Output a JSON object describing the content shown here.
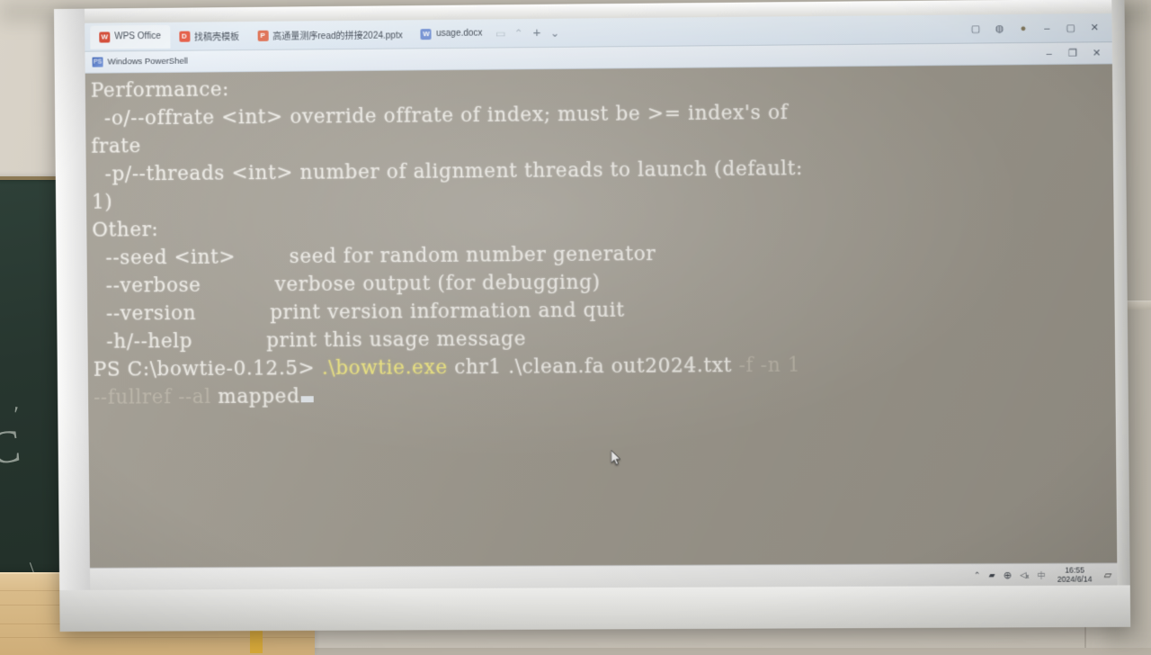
{
  "scene": {
    "description": "classroom projector screen showing Windows PowerShell",
    "chalkboard_label": "chalkboard",
    "chalk_marks": [
      "C",
      "'",
      "/"
    ]
  },
  "wps_tabs": {
    "tabs": [
      {
        "label": "WPS Office",
        "icon": "wps-logo-icon",
        "icon_class": "ic-wps",
        "icon_glyph": "W",
        "active": true
      },
      {
        "label": "找稿壳模板",
        "icon": "template-icon",
        "icon_class": "ic-doc",
        "icon_glyph": "D",
        "active": false
      },
      {
        "label": "高通量测序read的拼接2024.pptx",
        "icon": "powerpoint-icon",
        "icon_class": "ic-ppt",
        "icon_glyph": "P",
        "active": false
      },
      {
        "label": "usage.docx",
        "icon": "word-icon",
        "icon_class": "ic-docx",
        "icon_glyph": "W",
        "active": false
      }
    ],
    "tab_controls": [
      {
        "name": "tab-list-icon",
        "glyph": "▭"
      },
      {
        "name": "chevron-up-icon",
        "glyph": "⌃"
      },
      {
        "name": "new-tab-button",
        "glyph": "+"
      },
      {
        "name": "new-tab-dropdown-icon",
        "glyph": "⌄"
      }
    ],
    "right_controls": [
      {
        "name": "sidebar-toggle-icon",
        "glyph": "▢"
      },
      {
        "name": "globe-icon",
        "glyph": "◍"
      },
      {
        "name": "account-avatar",
        "glyph": "●"
      },
      {
        "name": "minimize-button",
        "glyph": "–"
      },
      {
        "name": "maximize-button",
        "glyph": "▢"
      },
      {
        "name": "close-button",
        "glyph": "✕"
      }
    ]
  },
  "powershell_window": {
    "title": "Windows PowerShell",
    "icon": "powershell-icon",
    "icon_glyph": "PS",
    "controls": [
      {
        "name": "minimize-button",
        "glyph": "–"
      },
      {
        "name": "maximize-button",
        "glyph": "❐"
      },
      {
        "name": "close-button",
        "glyph": "✕"
      }
    ]
  },
  "console": {
    "lines": [
      {
        "segments": [
          {
            "text": "Performance:",
            "style": "normal"
          }
        ]
      },
      {
        "segments": [
          {
            "text": "  -o/--offrate <int> override offrate of index; must be >= index's of",
            "style": "normal"
          }
        ]
      },
      {
        "segments": [
          {
            "text": "frate",
            "style": "normal"
          }
        ]
      },
      {
        "segments": [
          {
            "text": "  -p/--threads <int> number of alignment threads to launch (default:",
            "style": "normal"
          }
        ]
      },
      {
        "segments": [
          {
            "text": "1)",
            "style": "normal"
          }
        ]
      },
      {
        "segments": [
          {
            "text": "Other:",
            "style": "normal"
          }
        ]
      },
      {
        "segments": [
          {
            "text": "  --seed <int>        seed for random number generator",
            "style": "normal"
          }
        ]
      },
      {
        "segments": [
          {
            "text": "  --verbose           verbose output (for debugging)",
            "style": "normal"
          }
        ]
      },
      {
        "segments": [
          {
            "text": "  --version           print version information and quit",
            "style": "normal"
          }
        ]
      },
      {
        "segments": [
          {
            "text": "  -h/--help           print this usage message",
            "style": "normal"
          }
        ]
      },
      {
        "segments": [
          {
            "text": "PS C:\\bowtie-0.12.5> ",
            "style": "normal"
          },
          {
            "text": ".\\bowtie.exe",
            "style": "yellow"
          },
          {
            "text": " chr1 .\\clean.fa out2024.txt ",
            "style": "normal"
          },
          {
            "text": "-f -n 1",
            "style": "dim"
          }
        ]
      },
      {
        "segments": [
          {
            "text": "--fullref --al",
            "style": "dim"
          },
          {
            "text": " mapped",
            "style": "normal"
          },
          {
            "text": "",
            "style": "cursor"
          }
        ]
      }
    ]
  },
  "taskbar": {
    "icons": [
      {
        "name": "show-hidden-icons-chevron",
        "glyph": "⌃"
      },
      {
        "name": "folder-tray-icon",
        "glyph": "▰"
      },
      {
        "name": "network-globe-icon",
        "glyph": "⊕"
      },
      {
        "name": "volume-muted-icon",
        "glyph": "◁ₓ"
      },
      {
        "name": "ime-language-icon",
        "glyph": "中"
      }
    ],
    "clock": {
      "time": "16:55",
      "date": "2024/6/14"
    },
    "action_center": {
      "name": "notifications-icon",
      "glyph": "▱"
    }
  },
  "colors": {
    "console_bg": "#9f9a8f",
    "console_fg": "#eceae4",
    "accent_yellow": "#ece37a",
    "dim_fg": "#b9b3a6",
    "chalkboard": "#27362f",
    "wood": "#d9bb89"
  }
}
